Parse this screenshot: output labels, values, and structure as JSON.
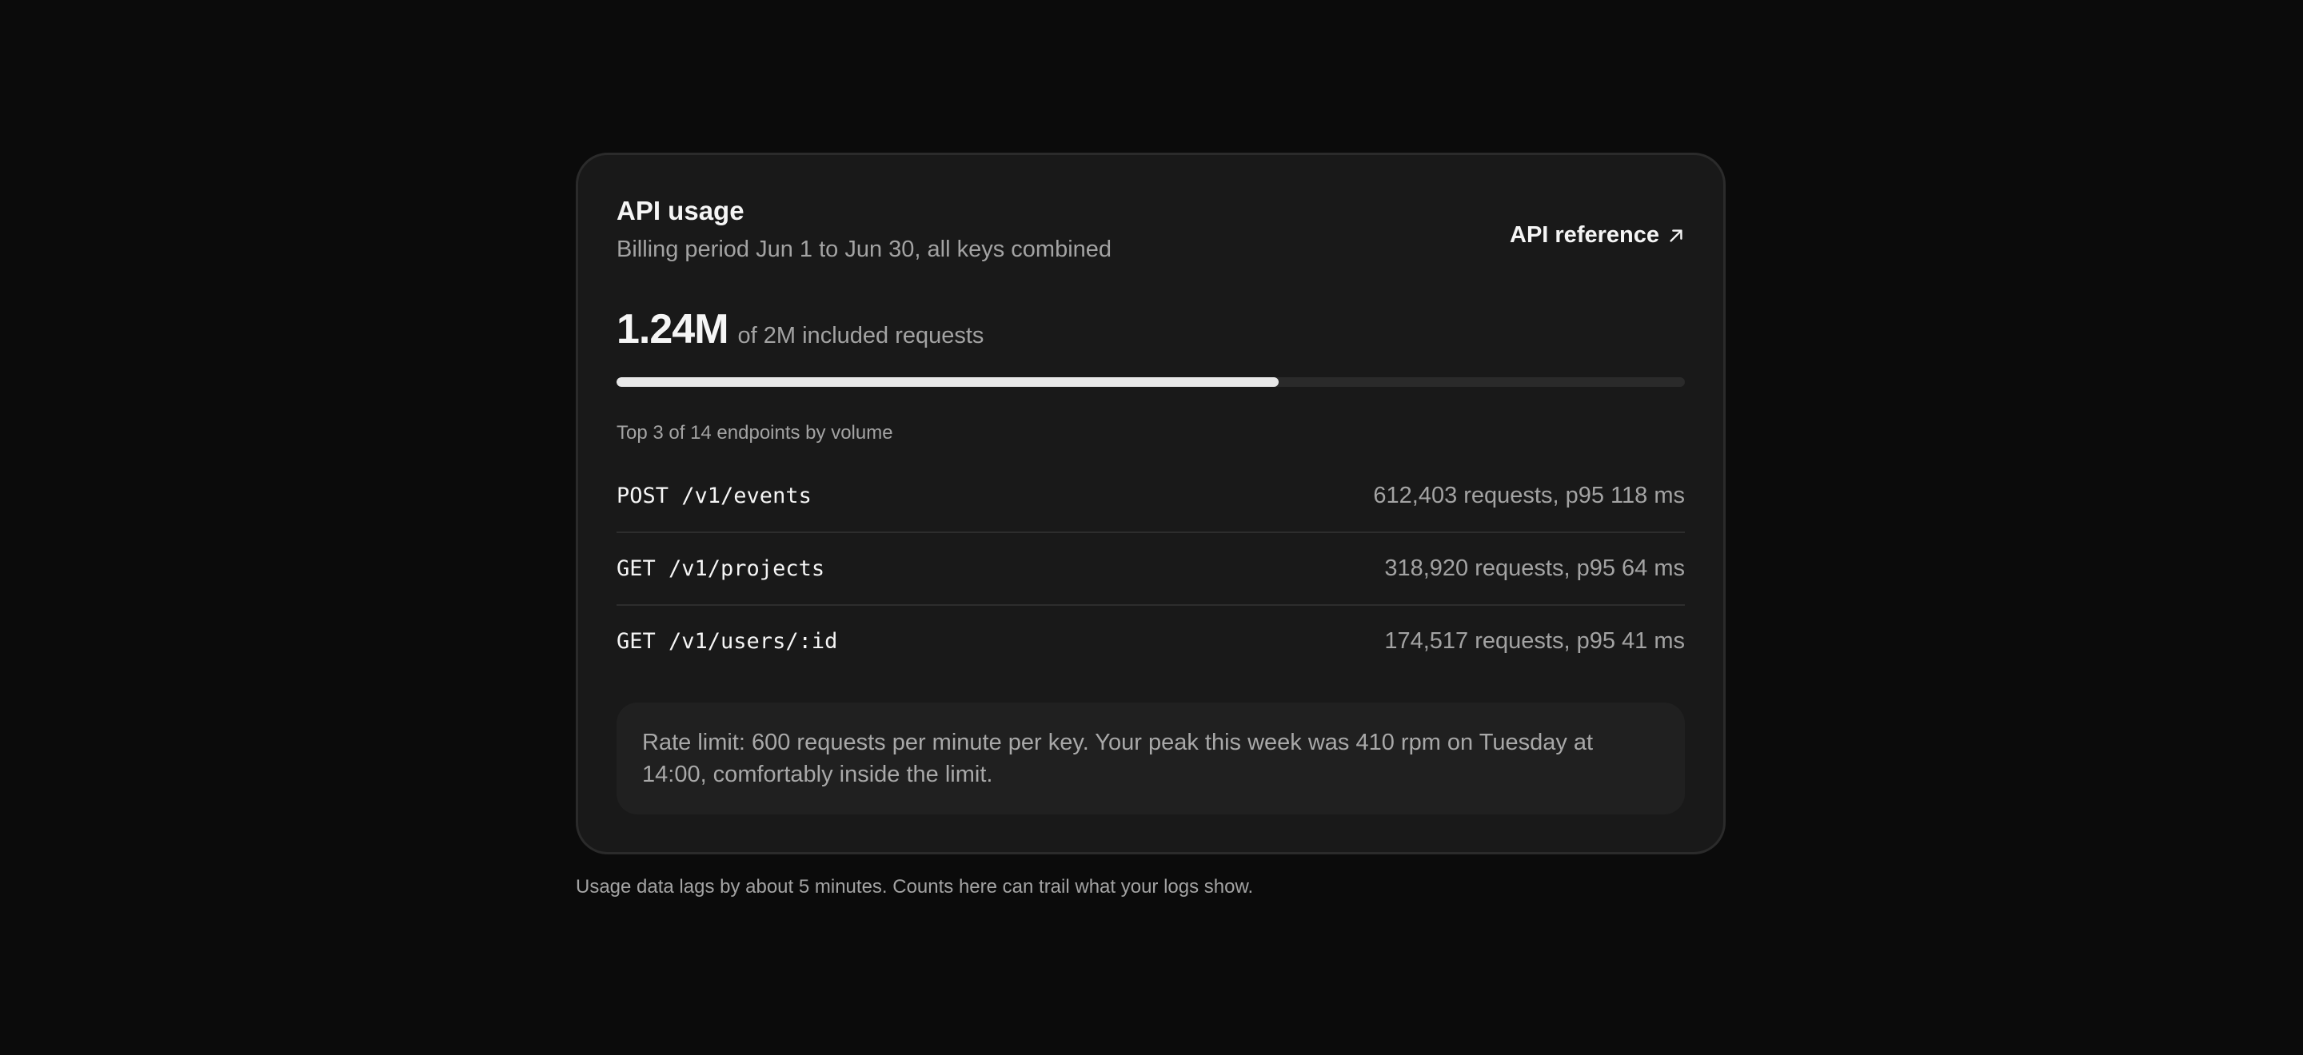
{
  "card": {
    "title": "API usage",
    "subtitle": "Billing period Jun 1 to Jun 30, all keys combined",
    "reference_link": "API reference",
    "reference_icon": "arrow-up-right-icon"
  },
  "usage": {
    "value": "1.24M",
    "caption": "of 2M included requests",
    "progress_fraction": 0.62
  },
  "endpoints": {
    "label": "Top 3 of 14 endpoints by volume",
    "rows": [
      {
        "path": "POST /v1/events",
        "stats": "612,403 requests, p95 118 ms"
      },
      {
        "path": "GET /v1/projects",
        "stats": "318,920 requests, p95 64 ms"
      },
      {
        "path": "GET /v1/users/:id",
        "stats": "174,517 requests, p95 41 ms"
      }
    ]
  },
  "rate_limit_note": "Rate limit: 600 requests per minute per key. Your peak this week was 410 rpm on Tuesday at 14:00, comfortably inside the limit.",
  "footnote": "Usage data lags by about 5 minutes. Counts here can trail what your logs show.",
  "colors": {
    "background": "#0b0b0b",
    "card": "#191919",
    "progress_fill": "#e8e8e8",
    "progress_track": "#2a2a2a"
  }
}
